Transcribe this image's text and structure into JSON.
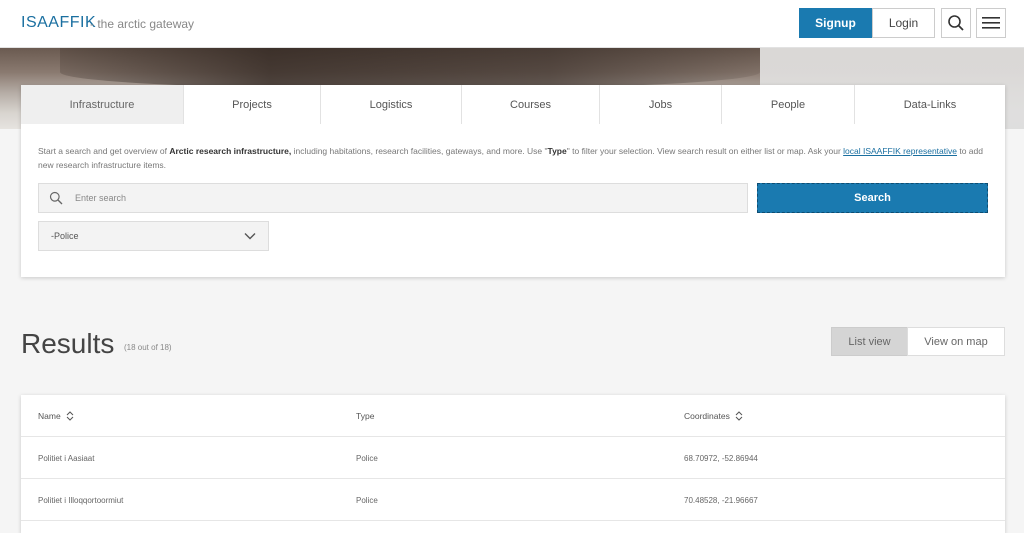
{
  "header": {
    "brand": "ISAAFFIK",
    "tagline": "- the arctic gateway",
    "signup_label": "Signup",
    "login_label": "Login"
  },
  "tabs": [
    {
      "label": "Infrastructure",
      "active": true
    },
    {
      "label": "Projects",
      "active": false
    },
    {
      "label": "Logistics",
      "active": false
    },
    {
      "label": "Courses",
      "active": false
    },
    {
      "label": "Jobs",
      "active": false
    },
    {
      "label": "People",
      "active": false
    },
    {
      "label": "Data-Links",
      "active": false
    }
  ],
  "intro": {
    "part1": "Start a search and get overview of ",
    "bold1": "Arctic research infrastructure,",
    "part2": " including habitations, research facilities, gateways, and more. Use \"",
    "bold2": "Type",
    "part3": "\" to filter your selection. View search result on either list or map. Ask your ",
    "link": "local ISAAFFIK representative",
    "part4": " to add new research infrastructure items."
  },
  "search": {
    "placeholder": "Enter search",
    "value": "",
    "button_label": "Search"
  },
  "type_filter": {
    "selected": "-Police"
  },
  "results": {
    "title": "Results",
    "count": "(18 out of 18)",
    "list_view_label": "List view",
    "map_view_label": "View on map"
  },
  "table": {
    "columns": [
      "Name",
      "Type",
      "Coordinates"
    ],
    "rows": [
      {
        "name": "Politiet i Aasiaat",
        "type": "Police",
        "coordinates": "68.70972, -52.86944"
      },
      {
        "name": "Politiet i Illoqqortoormiut",
        "type": "Police",
        "coordinates": "70.48528, -21.96667"
      }
    ]
  },
  "colors": {
    "accent": "#1a7ab0",
    "brand": "#1a6fa0"
  },
  "icons": {
    "search": "search-icon",
    "menu": "hamburger-menu-icon",
    "dropdown": "chevron-down-icon",
    "sort": "sort-icon"
  }
}
